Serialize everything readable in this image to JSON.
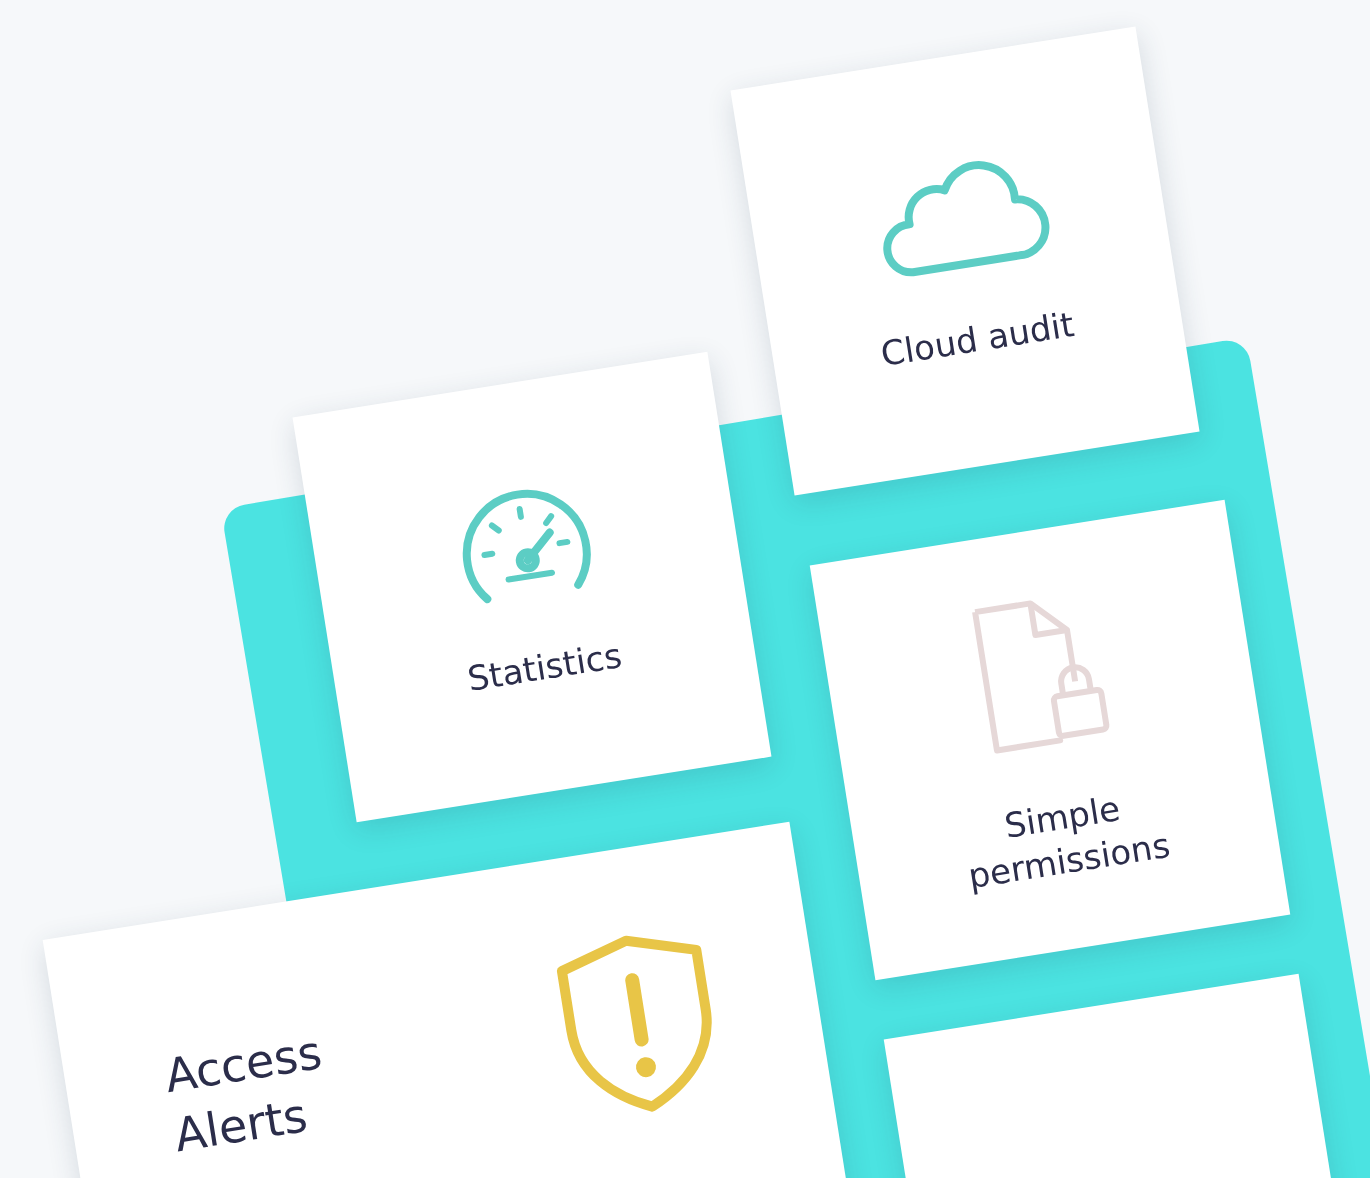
{
  "cards": [
    {
      "kind": "cloud",
      "label": "Cloud audit",
      "color": "#5ccdc4"
    },
    {
      "kind": "gauge",
      "label": "Statistics",
      "color": "#5ccdc4"
    },
    {
      "kind": "document-lock",
      "label": "Simple permissions",
      "color": "#e6d8d8"
    },
    {
      "kind": "shield-alert",
      "label": "Access Alerts",
      "color": "#e8c547"
    },
    {
      "kind": "blank"
    }
  ]
}
